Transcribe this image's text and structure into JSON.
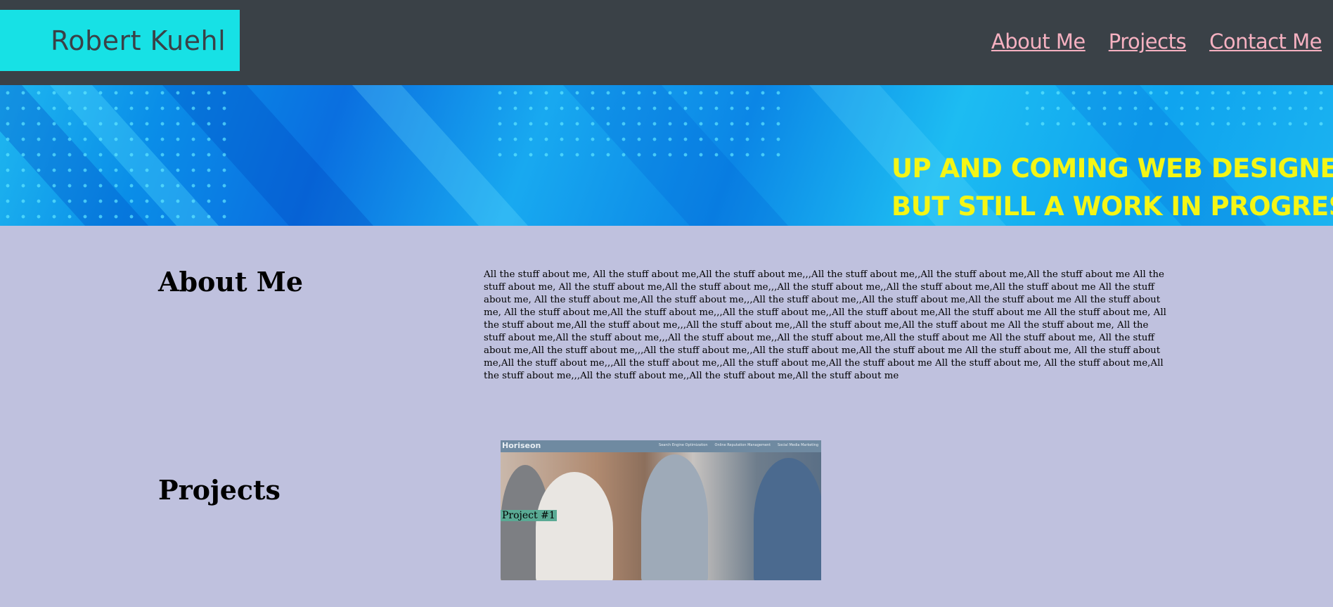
{
  "header": {
    "brand": "Robert Kuehl",
    "nav": [
      "About Me",
      "Projects",
      "Contact Me"
    ]
  },
  "hero": {
    "tagline_line1": "UP AND COMING WEB DESIGNER,",
    "tagline_line2": "BUT STILL A WORK IN PROGRESS"
  },
  "about": {
    "title": "About Me",
    "text": "All the stuff about me, All the stuff about me,All the stuff about me,,,All the stuff about me,,All the stuff about me,All the stuff about me All the stuff about me, All the stuff about me,All the stuff about me,,,All the stuff about me,,All the stuff about me,All the stuff about me All the stuff about me, All the stuff about me,All the stuff about me,,,All the stuff about me,,All the stuff about me,All the stuff about me All the stuff about me, All the stuff about me,All the stuff about me,,,All the stuff about me,,All the stuff about me,All the stuff about me All the stuff about me, All the stuff about me,All the stuff about me,,,All the stuff about me,,All the stuff about me,All the stuff about me All the stuff about me, All the stuff about me,All the stuff about me,,,All the stuff about me,,All the stuff about me,All the stuff about me All the stuff about me, All the stuff about me,All the stuff about me,,,All the stuff about me,,All the stuff about me,All the stuff about me All the stuff about me, All the stuff about me,All the stuff about me,,,All the stuff about me,,All the stuff about me,All the stuff about me All the stuff about me, All the stuff about me,All the stuff about me,,,All the stuff about me,,All the stuff about me,All the stuff about me"
  },
  "projects": {
    "title": "Projects",
    "items": [
      {
        "label": "Project #1",
        "screenshot_logo": "Horiseon",
        "screenshot_menu": [
          "Search Engine Optimization",
          "Online Reputation Management",
          "Social Media Marketing"
        ]
      }
    ]
  },
  "colors": {
    "header_bg": "#3a4147",
    "brand_bg": "#17e1e5",
    "nav_link": "#f6b1c1",
    "page_bg": "#bfc1de",
    "tagline": "#f4f616"
  }
}
